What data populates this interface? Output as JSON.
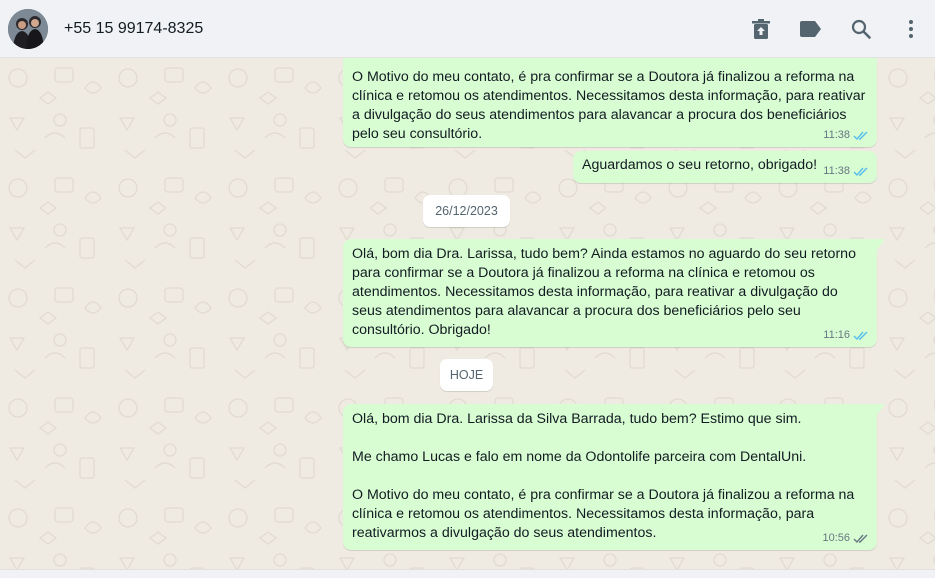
{
  "header": {
    "contact_name": "+55 15 99174-8325",
    "icons": [
      "delete-icon",
      "label-icon",
      "search-icon",
      "menu-icon"
    ]
  },
  "colors": {
    "outgoing_bubble": "#d9fdd3",
    "chat_background": "#efeae2",
    "header_background": "#f0f2f5",
    "read_ticks": "#53bdeb",
    "delivered_ticks": "#667781"
  },
  "messages": [
    {
      "text": "O Motivo do meu contato, é pra confirmar se a Doutora já finalizou a reforma na clínica e retomou os atendimentos. Necessitamos desta informação, para reativar a divulgação do seus atendimentos para alavancar a procura dos beneficiários pelo seu consultório.",
      "time": "11:38",
      "status": "read"
    },
    {
      "text": "Aguardamos o seu retorno, obrigado!",
      "time": "11:38",
      "status": "read"
    },
    {
      "text": "Olá, bom dia Dra. Larissa, tudo bem? Ainda estamos no aguardo do seu retorno para confirmar se a Doutora já finalizou a reforma na clínica e retomou os atendimentos. Necessitamos desta informação, para reativar a divulgação do seus atendimentos para alavancar a procura dos beneficiários pelo seu consultório. Obrigado!",
      "time": "11:16",
      "status": "read"
    },
    {
      "text": "Olá, bom dia Dra. Larissa da Silva Barrada, tudo bem? Estimo que sim.\n\nMe chamo Lucas e falo em nome da Odontolife parceira com DentalUni.\n\nO Motivo do meu contato, é pra confirmar se a Doutora já finalizou a reforma na clínica e retomou os atendimentos. Necessitamos desta informação, para reativarmos a divulgação do seus atendimentos.",
      "time": "10:56",
      "status": "delivered"
    }
  ],
  "date_separators": [
    "26/12/2023",
    "HOJE"
  ]
}
